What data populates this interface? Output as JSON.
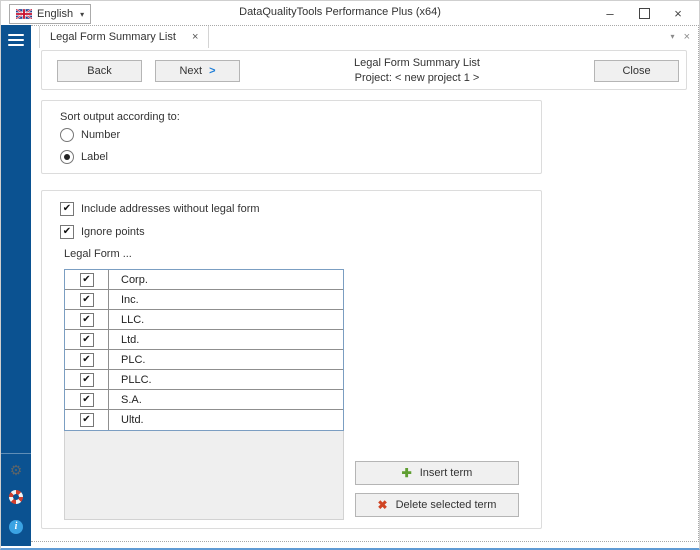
{
  "titlebar": {
    "language": {
      "label": "English",
      "dropdown_icon": "▾"
    },
    "title": "DataQualityTools Performance Plus (x64)",
    "minimize_icon": "–",
    "close_icon": "×"
  },
  "tabbar": {
    "tab_label": "Legal Form Summary List",
    "tab_close_icon": "×",
    "overflow_icon": "▾",
    "close_icon": "×"
  },
  "wizard_header": {
    "back_label": "Back",
    "next_label": "Next",
    "next_chevron": ">",
    "title": "Legal Form Summary List",
    "project": "Project: < new project 1 >",
    "close_label": "Close"
  },
  "sort_section": {
    "label": "Sort output according to:",
    "options": [
      {
        "label": "Number",
        "selected": false
      },
      {
        "label": "Label",
        "selected": true
      }
    ]
  },
  "options_section": {
    "checkboxes": [
      {
        "label": "Include addresses without legal form",
        "checked": true
      },
      {
        "label": "Ignore points",
        "checked": true
      }
    ],
    "list_label": "Legal Form ..."
  },
  "legal_forms": [
    {
      "label": "Corp.",
      "checked": true
    },
    {
      "label": "Inc.",
      "checked": true
    },
    {
      "label": "LLC.",
      "checked": true
    },
    {
      "label": "Ltd.",
      "checked": true
    },
    {
      "label": "PLC.",
      "checked": true
    },
    {
      "label": "PLLC.",
      "checked": true
    },
    {
      "label": "S.A.",
      "checked": true
    },
    {
      "label": "Ultd.",
      "checked": true
    }
  ],
  "actions": {
    "insert_label": "Insert term",
    "delete_label": "Delete selected term"
  },
  "icons": {
    "check": "✔",
    "plus": "✚",
    "cross": "✖",
    "gear": "⚙",
    "info": "i"
  },
  "colors": {
    "sidebar_blue": "#0b5291",
    "accent_blue": "#1c7cd6",
    "insert_green": "#5f9e31",
    "delete_red": "#d04423",
    "info_blue": "#3ba3e3"
  }
}
